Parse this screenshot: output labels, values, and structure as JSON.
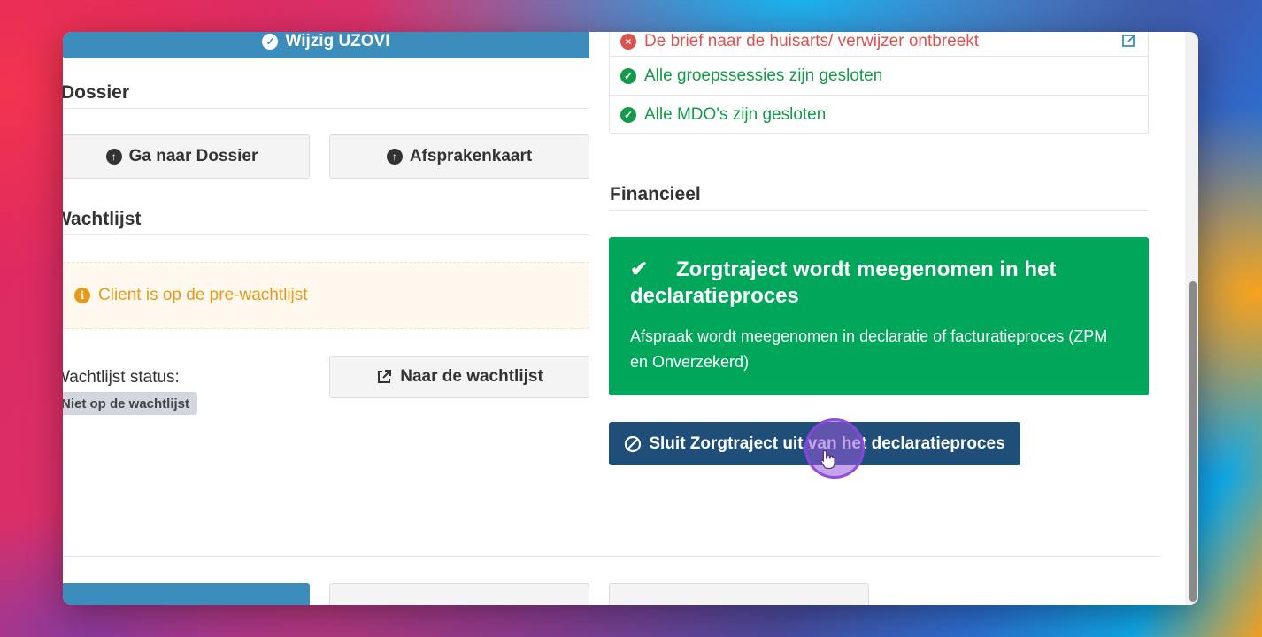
{
  "top": {
    "wijzig_uzovi_label": "Wijzig UZOVI"
  },
  "dossier": {
    "heading": "Dossier",
    "ga_naar_dossier_label": "Ga naar Dossier",
    "afsprakenkaart_label": "Afsprakenkaart"
  },
  "wachtlijst": {
    "heading": "Wachtlijst",
    "warning_text": "Client is op de pre-wachtlijst",
    "status_label": "Wachtlijst status:",
    "status_badge": "Niet op de wachtlijst",
    "naar_wachtlijst_label": "Naar de wachtlijst"
  },
  "checks": {
    "items": [
      {
        "text": "De brief naar de huisarts/ verwijzer ontbreekt",
        "status": "error"
      },
      {
        "text": "Alle groepssessies zijn gesloten",
        "status": "ok"
      },
      {
        "text": "Alle MDO's zijn gesloten",
        "status": "ok"
      }
    ]
  },
  "financieel": {
    "heading": "Financieel",
    "callout_title": "Zorgtraject wordt meegenomen in het declaratieproces",
    "callout_body": "Afspraak wordt meegenomen in declaratie of facturatieproces (ZPM en Onverzekerd)",
    "exclude_button_label": "Sluit Zorgtraject uit van het declaratieproces"
  },
  "colors": {
    "success": "#00a65a",
    "primary": "#3c8dbc",
    "navy": "#1f4e79",
    "warning": "#e69a1c",
    "danger": "#d9534f"
  }
}
